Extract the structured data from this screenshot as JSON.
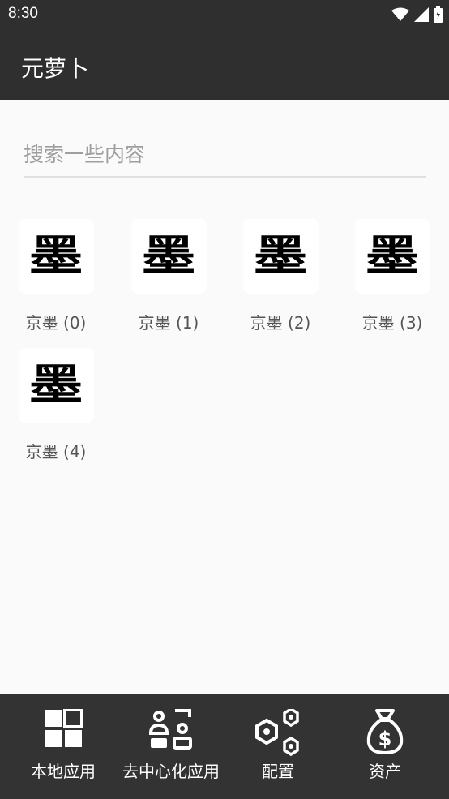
{
  "status_bar": {
    "time": "8:30"
  },
  "app_bar": {
    "title": "元萝卜"
  },
  "search": {
    "placeholder": "搜索一些内容",
    "value": ""
  },
  "apps": [
    {
      "glyph": "墨",
      "label": "京墨 (0)"
    },
    {
      "glyph": "墨",
      "label": "京墨 (1)"
    },
    {
      "glyph": "墨",
      "label": "京墨 (2)"
    },
    {
      "glyph": "墨",
      "label": "京墨 (3)"
    },
    {
      "glyph": "墨",
      "label": "京墨 (4)"
    }
  ],
  "bottom_nav": [
    {
      "label": "本地应用",
      "icon": "grid-icon"
    },
    {
      "label": "去中心化应用",
      "icon": "people-icon"
    },
    {
      "label": "配置",
      "icon": "hexagons-icon"
    },
    {
      "label": "资产",
      "icon": "money-bag-icon"
    }
  ],
  "colors": {
    "bar": "#2f2f2f",
    "nav": "#333333",
    "background": "#fafafa"
  }
}
